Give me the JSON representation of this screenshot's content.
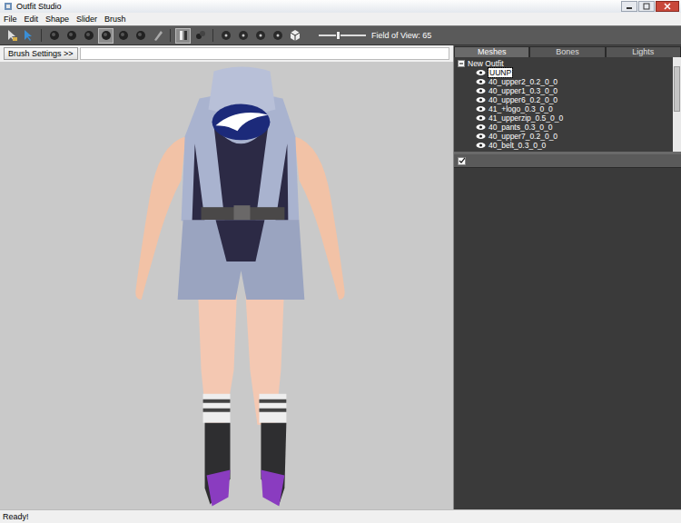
{
  "window": {
    "title": "Outfit Studio"
  },
  "menu": [
    "File",
    "Edit",
    "Shape",
    "Slider",
    "Brush"
  ],
  "toolbar": {
    "tool_groups": [
      [
        {
          "kind": "select",
          "selected": false
        },
        {
          "kind": "transform",
          "selected": false
        }
      ],
      [
        {
          "kind": "brush",
          "selected": false
        },
        {
          "kind": "brush",
          "selected": false
        },
        {
          "kind": "brush",
          "selected": false
        },
        {
          "kind": "brush",
          "selected": true
        },
        {
          "kind": "brush",
          "selected": false
        },
        {
          "kind": "brush",
          "selected": false
        },
        {
          "kind": "pen",
          "selected": false
        }
      ],
      [
        {
          "kind": "mirror",
          "selected": true
        },
        {
          "kind": "link",
          "selected": false
        }
      ],
      [
        {
          "kind": "dot",
          "selected": false
        },
        {
          "kind": "dot",
          "selected": false
        },
        {
          "kind": "dot",
          "selected": false
        },
        {
          "kind": "dot",
          "selected": false
        },
        {
          "kind": "cube",
          "selected": false
        }
      ]
    ],
    "fov": {
      "label": "Field of View: 65",
      "level": 0.4
    }
  },
  "brush_settings": "Brush Settings >>",
  "tabs": [
    {
      "label": "Meshes",
      "selected": true
    },
    {
      "label": "Bones",
      "selected": false
    },
    {
      "label": "Lights",
      "selected": false
    }
  ],
  "tree": {
    "root": "New Outfit",
    "expanded": true,
    "items": [
      {
        "label": "UUNP",
        "selected": true,
        "visible": true
      },
      {
        "label": "40_upper2_0.2_0_0",
        "selected": false,
        "visible": true
      },
      {
        "label": "40_upper1_0.3_0_0",
        "selected": false,
        "visible": true
      },
      {
        "label": "40_upper6_0.2_0_0",
        "selected": false,
        "visible": true
      },
      {
        "label": "41_+logo_0.3_0_0",
        "selected": false,
        "visible": true
      },
      {
        "label": "41_upperzip_0.5_0_0",
        "selected": false,
        "visible": true
      },
      {
        "label": "40_pants_0.3_0_0",
        "selected": false,
        "visible": true
      },
      {
        "label": "40_upper7_0.2_0_0",
        "selected": false,
        "visible": true
      },
      {
        "label": "40_belt_0.3_0_0",
        "selected": false,
        "visible": true
      }
    ]
  },
  "slider_panel": {
    "checked": true
  },
  "status_bar": "Ready!"
}
